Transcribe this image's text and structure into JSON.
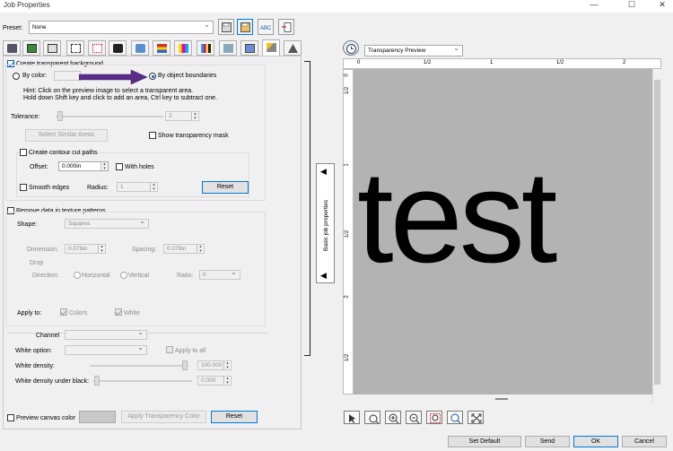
{
  "window": {
    "title": "Job Properties",
    "minimize": "—",
    "maximize": "☐",
    "close": "✕"
  },
  "preset": {
    "label": "Preset:",
    "value": "None"
  },
  "transparency": {
    "create_bg": "Create transparent background",
    "by_color": "By color:",
    "by_object": "By object boundaries",
    "hint1": "Hint: Click on the preview image to select a transparent area.",
    "hint2": "Hold down Shift key and click to add an area, Ctrl key to subtract one.",
    "tolerance_label": "Tolerance:",
    "tolerance_value": "2",
    "select_similar": "Select Similar Areas",
    "show_mask": "Show transparency mask"
  },
  "contour": {
    "create": "Create contour cut paths",
    "offset_label": "Offset:",
    "offset_value": "0.000in",
    "with_holes": "With holes",
    "smooth": "Smooth edges",
    "radius_label": "Radius:",
    "radius_value": "1",
    "reset": "Reset"
  },
  "texture": {
    "remove": "Remove data in texture patterns",
    "shape_label": "Shape:",
    "shape_value": "Squares",
    "dimension_label": "Dimension:",
    "dimension_value": "0.079in",
    "spacing_label": "Spacing:",
    "spacing_value": "0.079in",
    "drop_label": "Drop",
    "direction_label": "Direction:",
    "horizontal": "Horizontal",
    "vertical": "Vertical",
    "ratio_label": "Ratio:",
    "ratio_value": "0",
    "apply_label": "Apply to:",
    "colors": "Colors",
    "white": "White"
  },
  "white": {
    "channel_label": "Channel",
    "white_option_label": "White option:",
    "apply_all": "Apply to all",
    "density_label": "White density:",
    "density_value": "100.000",
    "density_black_label": "White density under black:",
    "density_black_value": "0.000"
  },
  "canvas": {
    "preview_label": "Preview canvas color",
    "apply_color": "Apply Transparency Color",
    "reset": "Reset"
  },
  "preview": {
    "mode": "Transparency Preview",
    "side_tab": "Basic job properties",
    "text": "test",
    "h_ticks": [
      "0",
      "1/2",
      "1",
      "1/2",
      "2"
    ],
    "v_ticks": [
      "0",
      "1/2",
      "1",
      "1/2",
      "2",
      "1/2"
    ],
    "background": "#b3b3b3"
  },
  "footer": {
    "set_default": "Set Default",
    "send": "Send",
    "ok": "OK",
    "cancel": "Cancel"
  },
  "colors": {
    "arrow": "#5b2c8a",
    "accent": "#0078d7"
  }
}
